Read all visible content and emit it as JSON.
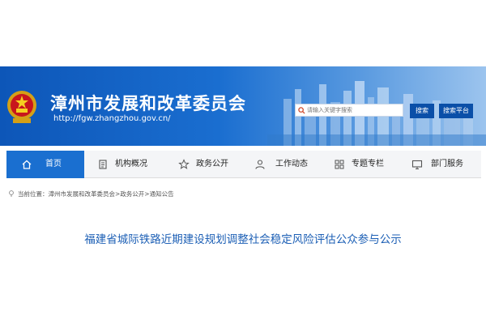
{
  "header": {
    "site_title": "漳州市发展和改革委员会",
    "site_url": "http://fgw.zhangzhou.gov.cn/",
    "search": {
      "placeholder": "请输入关键字搜索"
    },
    "search_button": "搜索",
    "search_platform_button": "搜索平台"
  },
  "nav": {
    "items": [
      {
        "label": "首页",
        "icon": "home-icon",
        "active": true
      },
      {
        "label": "机构概况",
        "icon": "document-icon"
      },
      {
        "label": "政务公开",
        "icon": "star-icon"
      },
      {
        "label": "工作动态",
        "icon": "user-icon"
      },
      {
        "label": "专题专栏",
        "icon": "grid-icon"
      },
      {
        "label": "部门服务",
        "icon": "monitor-icon"
      }
    ]
  },
  "breadcrumb": {
    "label": "当前位置：",
    "items": [
      "漳州市发展和改革委员会",
      "政务公开",
      "通知公告"
    ],
    "separator": ">"
  },
  "article": {
    "title": "福建省城际铁路近期建设规划调整社会稳定风险评估公众参与公示"
  },
  "colors": {
    "banner": "#1a6ed0",
    "nav_active": "#1a6fd0",
    "title": "#1c5fb5",
    "button": "#0a4fa8"
  }
}
